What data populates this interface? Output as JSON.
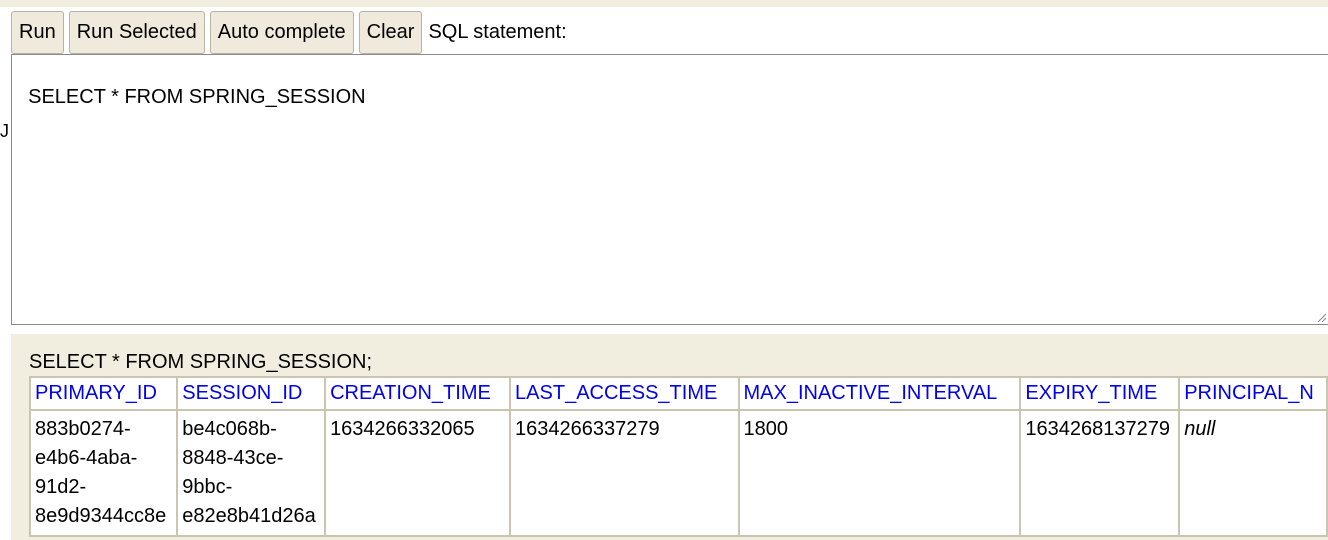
{
  "toolbar": {
    "run_label": "Run",
    "run_selected_label": "Run Selected",
    "auto_complete_label": "Auto complete",
    "clear_label": "Clear",
    "sql_statement_label": "SQL statement:"
  },
  "left_fragment": "J",
  "editor": {
    "value": "SELECT * FROM SPRING_SESSION"
  },
  "result": {
    "executed_sql": "SELECT * FROM SPRING_SESSION;",
    "columns": [
      "PRIMARY_ID",
      "SESSION_ID",
      "CREATION_TIME",
      "LAST_ACCESS_TIME",
      "MAX_INACTIVE_INTERVAL",
      "EXPIRY_TIME",
      "PRINCIPAL_N"
    ],
    "rows": [
      {
        "primary_id_lines": [
          "883b0274-",
          "e4b6-4aba-",
          "91d2-",
          "8e9d9344cc8e"
        ],
        "session_id_lines": [
          "be4c068b-",
          "8848-43ce-",
          "9bbc-",
          "e82e8b41d26a"
        ],
        "creation_time": "1634266332065",
        "last_access_time": "1634266337279",
        "max_inactive_interval": "1800",
        "expiry_time": "1634268137279",
        "principal_name": "null"
      }
    ]
  }
}
